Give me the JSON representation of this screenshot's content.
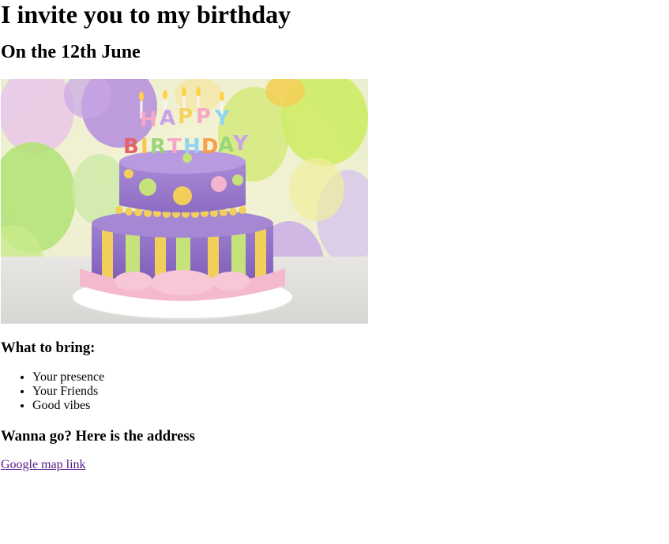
{
  "header": {
    "title": "I invite you to my birthday",
    "date": "On the 12th June"
  },
  "hero": {
    "image": "birthday-cake-with-balloons",
    "cake_text_top": "HAPPY",
    "cake_text_bottom": "BIRTHDAY"
  },
  "bring": {
    "heading": "What to bring:",
    "items": [
      "Your presence",
      "Your Friends",
      "Good vibes"
    ]
  },
  "address": {
    "heading": "Wanna go? Here is the address",
    "link_label": "Google map link"
  },
  "colors": {
    "link_visited": "#551a8b"
  }
}
